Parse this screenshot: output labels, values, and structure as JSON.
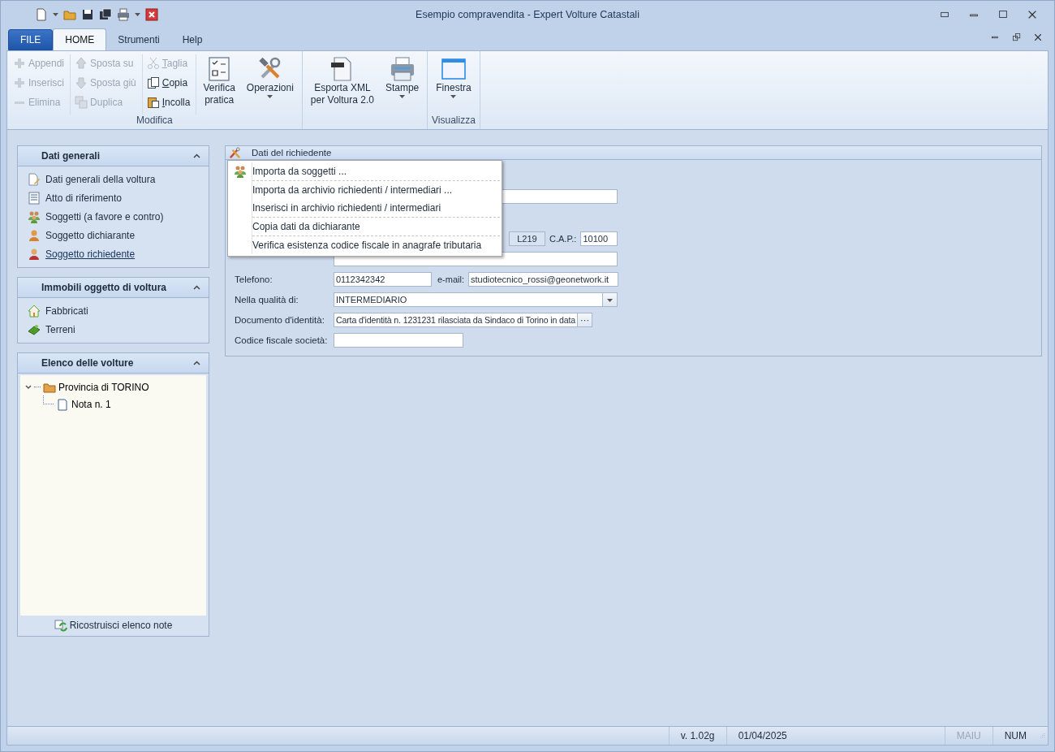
{
  "window": {
    "title": "Esempio compravendita - Expert Volture Catastali"
  },
  "ribbon_tabs": [
    {
      "label": "FILE",
      "kind": "file",
      "selected": false
    },
    {
      "label": "HOME",
      "kind": "tab",
      "selected": true
    },
    {
      "label": "Strumenti",
      "kind": "tab",
      "selected": false
    },
    {
      "label": "Help",
      "kind": "tab",
      "selected": false
    }
  ],
  "ribbon_groups": [
    {
      "label": "Modifica",
      "small_columns": [
        [
          {
            "label": "Appendi",
            "disabled": true,
            "accel": false
          },
          {
            "label": "Inserisci",
            "disabled": true,
            "accel": false
          },
          {
            "label": "Elimina",
            "disabled": true,
            "accel": false
          }
        ],
        [
          {
            "label": "Sposta su",
            "disabled": true,
            "accel": false
          },
          {
            "label": "Sposta giù",
            "disabled": true,
            "accel": false
          },
          {
            "label": "Duplica",
            "disabled": true,
            "accel": false
          }
        ],
        [
          {
            "label": "Taglia",
            "disabled": true,
            "accel": true
          },
          {
            "label": "Copia",
            "disabled": false,
            "accel": true
          },
          {
            "label": "Incolla",
            "disabled": false,
            "accel": true
          }
        ]
      ],
      "large": [
        {
          "label": "Verifica\npratica",
          "dropdown": false
        },
        {
          "label": "Operazioni",
          "dropdown": true
        }
      ]
    },
    {
      "large": [
        {
          "label": "Esporta XML\nper Voltura 2.0",
          "dropdown": false
        },
        {
          "label": "Stampe",
          "dropdown": true
        }
      ]
    },
    {
      "label": "Visualizza",
      "large": [
        {
          "label": "Finestra",
          "dropdown": true
        }
      ]
    }
  ],
  "sidebar": [
    {
      "title": "Dati generali",
      "expanded": true,
      "items": [
        {
          "label": "Dati generali della voltura",
          "selected": false
        },
        {
          "label": "Atto di riferimento",
          "selected": false
        },
        {
          "label": "Soggetti (a favore e contro)",
          "selected": false
        },
        {
          "label": "Soggetto dichiarante",
          "selected": false
        },
        {
          "label": "Soggetto richiedente",
          "selected": true
        }
      ]
    },
    {
      "title": "Immobili oggetto di voltura",
      "expanded": true,
      "items": [
        {
          "label": "Fabbricati",
          "selected": false
        },
        {
          "label": "Terreni",
          "selected": false
        }
      ]
    }
  ],
  "volture": {
    "title": "Elenco delle volture",
    "expanded": true,
    "tree": [
      {
        "label": "Provincia di TORINO",
        "expanded": true,
        "children": [
          {
            "label": "Nota n. 1"
          }
        ]
      }
    ],
    "button": "Ricostruisci elenco note"
  },
  "form": {
    "title": "Dati del richiedente",
    "rows": [
      {
        "kind": "blank"
      },
      {
        "kind": "code",
        "code": "L219",
        "cap_label": "C.A.P.:",
        "cap": "10100"
      },
      {
        "kind": "blank"
      },
      {
        "kind": "contact",
        "label": "Telefono:",
        "value": "0112342342",
        "email_label": "e-mail:",
        "email": "studiotecnico_rossi@geonetwork.it"
      },
      {
        "kind": "select",
        "label": "Nella qualità di:",
        "value": "INTERMEDIARIO"
      },
      {
        "kind": "browse",
        "label": "Documento d'identità:",
        "value": "Carta d'identità n. 1231231 rilasciata da Sindaco di Torino in data",
        "button": "···"
      },
      {
        "kind": "text",
        "label": "Codice fiscale società:",
        "value": ""
      }
    ]
  },
  "context_menu": [
    {
      "label": "Importa da soggetti ...",
      "separator_after": true
    },
    {
      "label": "Importa da archivio richiedenti / intermediari ...",
      "separator_after": false
    },
    {
      "label": "Inserisci in archivio richiedenti / intermediari",
      "separator_after": true
    },
    {
      "label": "Copia dati da dichiarante",
      "separator_after": true
    },
    {
      "label": "Verifica esistenza codice fiscale in anagrafe tributaria",
      "separator_after": false
    }
  ],
  "status_bar": [
    {
      "text": "v. 1.02g",
      "disabled": false
    },
    {
      "text": "01/04/2025",
      "disabled": false
    },
    {
      "text": "MAIU",
      "disabled": true
    },
    {
      "text": "NUM",
      "disabled": false
    }
  ]
}
